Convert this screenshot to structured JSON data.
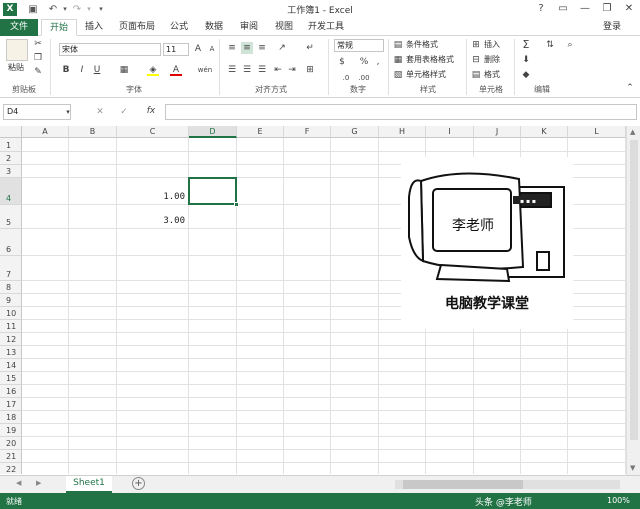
{
  "app": {
    "title": "工作簿1 - Excel",
    "logo": "X",
    "signin": "登录",
    "quick_access": [
      "save-icon",
      "undo-icon",
      "redo-icon"
    ],
    "window_controls": [
      "?",
      "▭",
      "—",
      "❐",
      "✕"
    ]
  },
  "tabs": [
    {
      "label": "文件"
    },
    {
      "label": "开始"
    },
    {
      "label": "插入"
    },
    {
      "label": "页面布局"
    },
    {
      "label": "公式"
    },
    {
      "label": "数据"
    },
    {
      "label": "审阅"
    },
    {
      "label": "视图"
    },
    {
      "label": "开发工具"
    }
  ],
  "ribbon": {
    "clipboard": {
      "label": "剪贴板",
      "paste": "粘贴"
    },
    "font": {
      "label": "字体",
      "name": "宋体",
      "size": "11",
      "bold": "B",
      "italic": "I",
      "underline": "U",
      "grow": "A",
      "shrink": "A",
      "font_color": "A",
      "wen": "wén"
    },
    "alignment": {
      "label": "对齐方式"
    },
    "number": {
      "label": "数字",
      "format": "常规",
      "percent": "%",
      "comma": ","
    },
    "styles": {
      "label": "样式",
      "conditional": "条件格式",
      "table": "套用表格格式",
      "cell_styles": "单元格样式"
    },
    "cells": {
      "label": "单元格",
      "insert": "插入",
      "delete": "删除",
      "format": "格式"
    },
    "editing": {
      "label": "编辑",
      "sum": "Σ"
    }
  },
  "formula_bar": {
    "name_box": "D4",
    "fx": "fx",
    "value": ""
  },
  "sheet": {
    "columns": [
      "A",
      "B",
      "C",
      "D",
      "E",
      "F",
      "G",
      "H",
      "I",
      "J",
      "K",
      "L"
    ],
    "rows": [
      "1",
      "2",
      "3",
      "4",
      "5",
      "6",
      "7",
      "8",
      "9",
      "10",
      "11",
      "12",
      "13",
      "14",
      "15",
      "16",
      "17",
      "18",
      "19",
      "20",
      "21",
      "22"
    ],
    "selected_cell": "D4",
    "cells": {
      "C4": "1.00",
      "C5": "3.00"
    }
  },
  "picture": {
    "screen_text": "李老师",
    "caption": "电脑教学课堂"
  },
  "sheet_tabs": [
    {
      "label": "Sheet1"
    }
  ],
  "status": {
    "ready": "就绪",
    "zoom": "100%",
    "watermark": "头条 @李老师"
  },
  "colors": {
    "accent": "#217346",
    "grid": "#e2e2e2"
  }
}
